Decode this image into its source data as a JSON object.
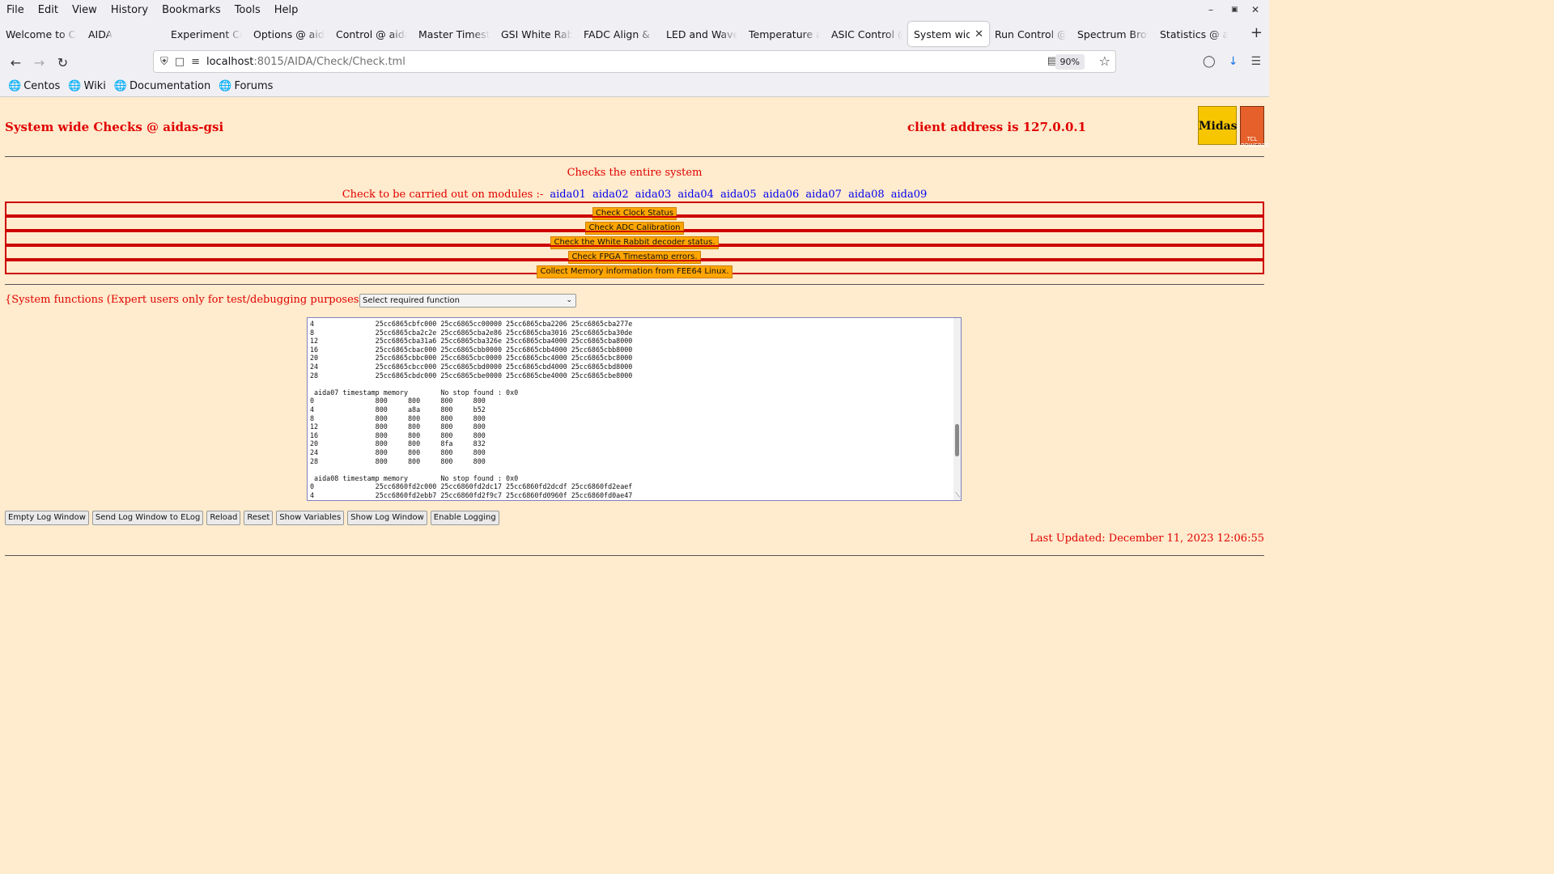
{
  "browser": {
    "menu": [
      "File",
      "Edit",
      "View",
      "History",
      "Bookmarks",
      "Tools",
      "Help"
    ],
    "tabs": [
      {
        "label": "Welcome to Ce",
        "active": false
      },
      {
        "label": "AIDA",
        "active": false
      },
      {
        "label": "Experiment Con",
        "active": false
      },
      {
        "label": "Options @ aidas",
        "active": false
      },
      {
        "label": "Control @ aidas",
        "active": false
      },
      {
        "label": "Master Timestam",
        "active": false
      },
      {
        "label": "GSI White Rabbi",
        "active": false
      },
      {
        "label": "FADC Align & Co",
        "active": false
      },
      {
        "label": "LED and Wavefo",
        "active": false
      },
      {
        "label": "Temperature and",
        "active": false
      },
      {
        "label": "ASIC Control @",
        "active": false
      },
      {
        "label": "System wide C",
        "active": true
      },
      {
        "label": "Run Control @ a",
        "active": false
      },
      {
        "label": "Spectrum Brows",
        "active": false
      },
      {
        "label": "Statistics @ aida",
        "active": false
      }
    ],
    "url_host": "localhost",
    "url_path": ":8015/AIDA/Check/Check.tml",
    "zoom": "90%",
    "bookmarks": [
      "Centos",
      "Wiki",
      "Documentation",
      "Forums"
    ]
  },
  "page": {
    "title": "System wide Checks @ aidas-gsi",
    "client_address": "client address is 127.0.0.1",
    "logo_midas": "Midas",
    "logo_tcl": "TCL POWERED",
    "checks_desc": "Checks the entire system",
    "modules_prefix": "Check to be carried out on modules :-",
    "modules": [
      "aida01",
      "aida02",
      "aida03",
      "aida04",
      "aida05",
      "aida06",
      "aida07",
      "aida08",
      "aida09"
    ],
    "check_buttons": [
      "Check Clock Status",
      "Check ADC Calibration",
      "Check the White Rabbit decoder status.",
      "Check FPGA Timestamp errors.",
      "Collect Memory information from FEE64 Linux."
    ],
    "sysfunc_label": "{System functions (Expert users only for test/debugging purposes!!!)  } {",
    "sysfunc_select": "Select required function",
    "log_lines": [
      "4               25cc6865cbfc000 25cc6865cc00000 25cc6865cba2206 25cc6865cba277e",
      "8               25cc6865cba2c2e 25cc6865cba2e86 25cc6865cba3016 25cc6865cba30de",
      "12              25cc6865cba31a6 25cc6865cba326e 25cc6865cba4000 25cc6865cba8000",
      "16              25cc6865cbac000 25cc6865cbb0000 25cc6865cbb4000 25cc6865cbb8000",
      "20              25cc6865cbbc000 25cc6865cbc0000 25cc6865cbc4000 25cc6865cbc8000",
      "24              25cc6865cbcc000 25cc6865cbd0000 25cc6865cbd4000 25cc6865cbd8000",
      "28              25cc6865cbdc000 25cc6865cbe0000 25cc6865cbe4000 25cc6865cbe8000",
      "",
      " aida07 timestamp memory        No stop found : 0x0",
      "0               800     800     800     800",
      "4               800     a8a     800     b52",
      "8               800     800     800     800",
      "12              800     800     800     800",
      "16              800     800     800     800",
      "20              800     800     8fa     832",
      "24              800     800     800     800",
      "28              800     800     800     800",
      "",
      " aida08 timestamp memory        No stop found : 0x0",
      "0               25cc6860fd2c000 25cc6860fd2dc17 25cc6860fd2dcdf 25cc6860fd2eaef",
      "4               25cc6860fd2ebb7 25cc6860fd2f9c7 25cc6860fd0960f 25cc6860fd0ae47"
    ],
    "bottom_buttons": [
      "Empty Log Window",
      "Send Log Window to ELog",
      "Reload",
      "Reset",
      "Show Variables",
      "Show Log Window",
      "Enable Logging"
    ],
    "last_updated": "Last Updated: December 11, 2023 12:06:55"
  }
}
